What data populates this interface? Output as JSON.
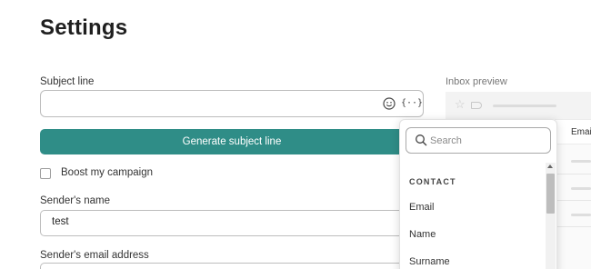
{
  "page": {
    "title": "Settings"
  },
  "subject": {
    "label": "Subject line",
    "value": "",
    "emoji_icon": "smiley-icon",
    "variable_icon": "variable-braces-icon",
    "variable_glyph": "{··}"
  },
  "generate": {
    "label": "Generate subject line",
    "color": "#2f8d87"
  },
  "boost": {
    "label": "Boost my campaign",
    "checked": false
  },
  "sender_name": {
    "label": "Sender's name",
    "value": "test"
  },
  "sender_email": {
    "label": "Sender's email address",
    "value": ""
  },
  "inbox_preview": {
    "label": "Inbox preview",
    "email_tab": "Email",
    "star_glyph": "☆"
  },
  "dropdown": {
    "search_placeholder": "Search",
    "section": "CONTACT",
    "options": [
      "Email",
      "Name",
      "Surname"
    ]
  }
}
